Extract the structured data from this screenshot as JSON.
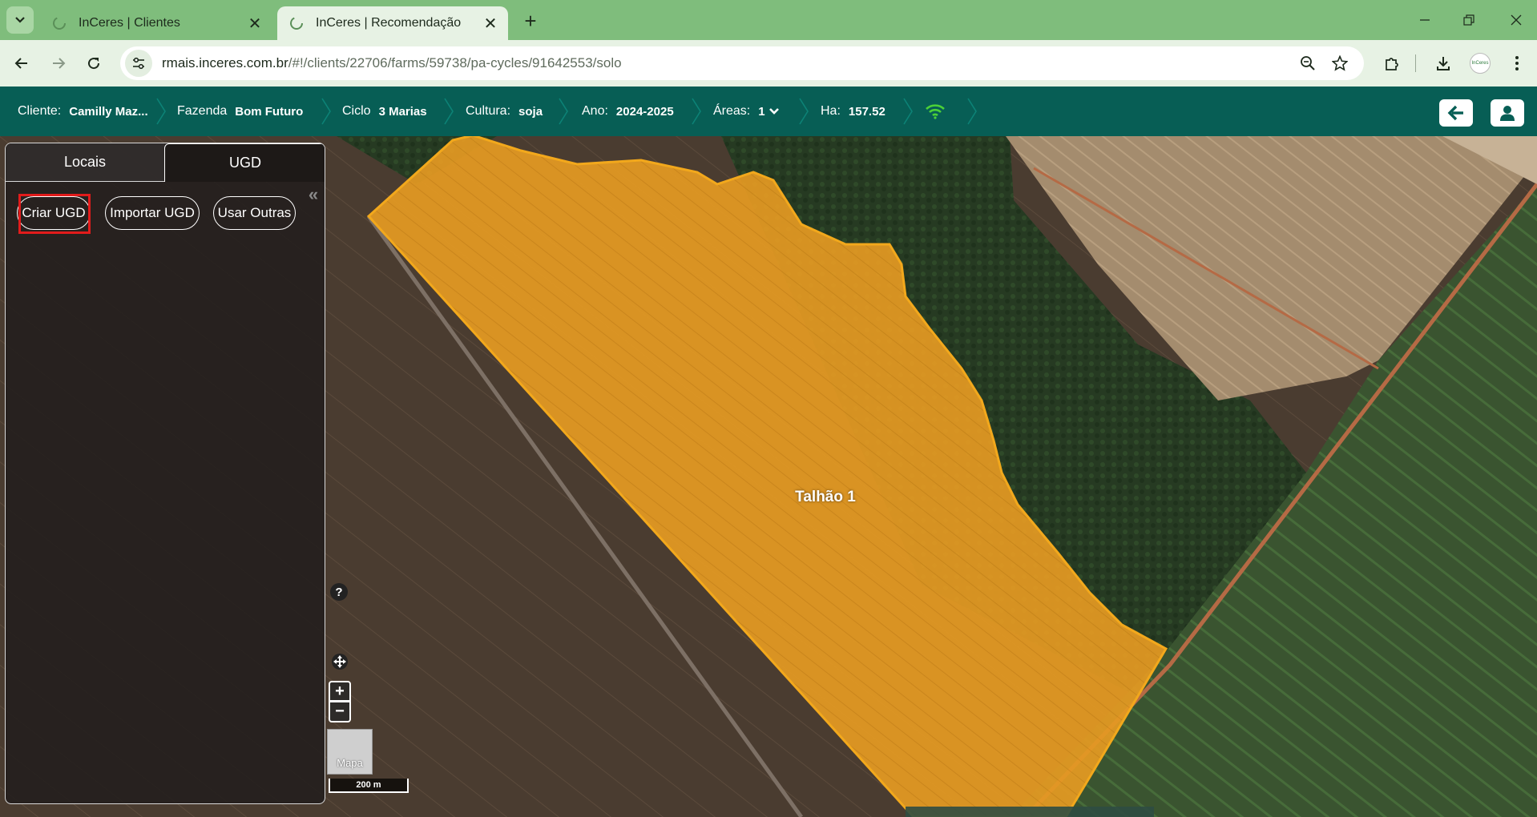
{
  "browser": {
    "tabs": [
      {
        "title": "InCeres | Clientes",
        "active": false
      },
      {
        "title": "InCeres | Recomendação",
        "active": true
      }
    ],
    "url_host": "rmais.inceres.com.br",
    "url_path": "/#!/clients/22706/farms/59738/pa-cycles/91642553/solo",
    "profile_text": "InCeres",
    "icons": {
      "tab_menu": "chevron-down-icon",
      "back": "arrow-left-icon",
      "forward": "arrow-right-icon",
      "reload": "reload-icon",
      "site_info": "tune-icon",
      "zoom": "zoom-icon",
      "bookmark": "star-icon",
      "extensions": "puzzle-icon",
      "downloads": "download-icon",
      "menu": "kebab-menu-icon"
    }
  },
  "header": {
    "cliente_label": "Cliente:",
    "cliente_value": "Camilly Maz...",
    "fazenda_label": "Fazenda",
    "fazenda_value": "Bom Futuro",
    "ciclo_label": "Ciclo",
    "ciclo_value": "3 Marias",
    "cultura_label": "Cultura:",
    "cultura_value": "soja",
    "ano_label": "Ano:",
    "ano_value": "2024-2025",
    "areas_label": "Áreas:",
    "areas_value": "1",
    "ha_label": "Ha:",
    "ha_value": "157.52",
    "colors": {
      "bar": "#075e55",
      "wifi": "#4cd137"
    }
  },
  "side_panel": {
    "tabs": [
      {
        "label": "Locais",
        "active": false
      },
      {
        "label": "UGD",
        "active": true
      }
    ],
    "buttons": {
      "criar": "Criar UGD",
      "importar": "Importar UGD",
      "usar": "Usar Outras"
    },
    "collapse_glyph": "«"
  },
  "map": {
    "field_label": "Talhão 1",
    "field_color": "#f0a21e",
    "help_glyph": "?",
    "zoom_in": "+",
    "zoom_out": "−",
    "layer_label": "Mapa",
    "scale": "200 m"
  }
}
